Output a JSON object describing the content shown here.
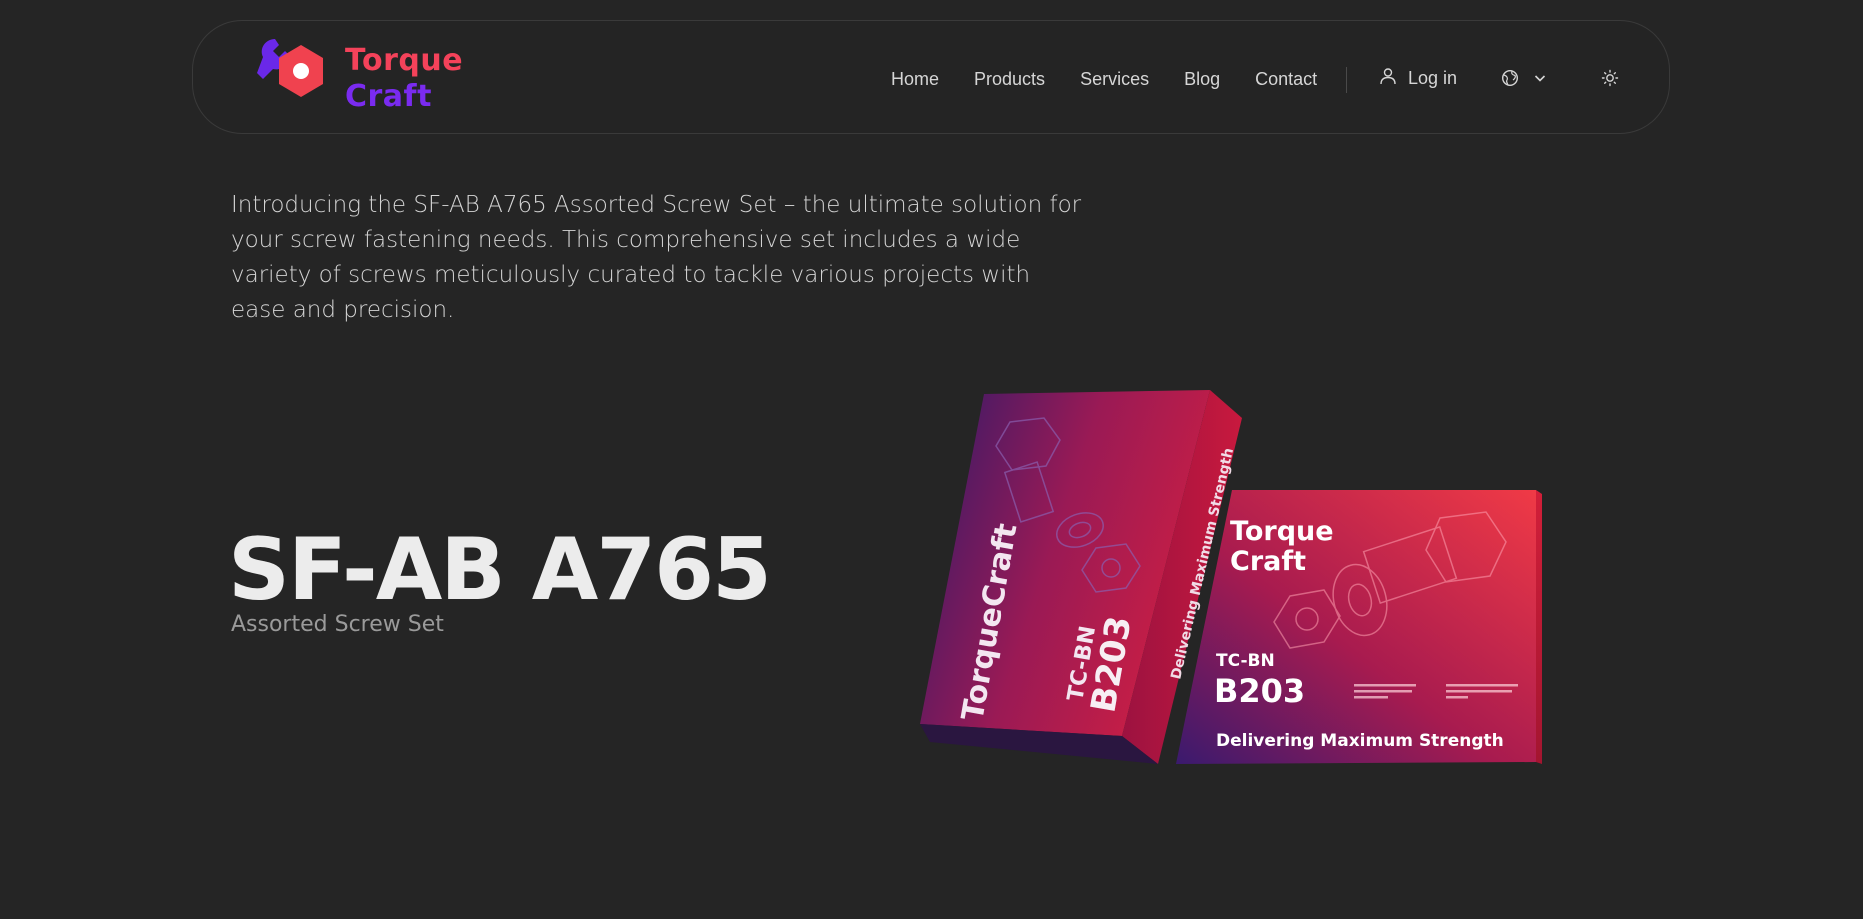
{
  "brand": {
    "line1": "Torque",
    "line2": "Craft",
    "colors": {
      "primary": "#f4425a",
      "secondary": "#7a2bf0"
    }
  },
  "nav": {
    "links": [
      "Home",
      "Products",
      "Services",
      "Blog",
      "Contact"
    ],
    "login_label": "Log in",
    "language_icon": "globe-icon",
    "theme_icon": "sun-icon"
  },
  "intro": {
    "text": "Introducing the SF-AB A765 Assorted Screw Set – the ultimate solution for your screw fastening needs. This comprehensive set includes a wide variety of screws meticulously curated to tackle various projects with ease and precision."
  },
  "hero": {
    "title": "SF-AB A765",
    "subtitle": "Assorted Screw Set"
  },
  "product_image": {
    "brand_vertical": "TorqueCraft",
    "brand_front_line1": "Torque",
    "brand_front_line2": "Craft",
    "model_prefix": "TC-BN",
    "model_code": "B203",
    "tagline": "Delivering Maximum Strength",
    "colors": {
      "box_start": "#3a1a6e",
      "box_mid": "#9d1a52",
      "box_end": "#ef3346"
    }
  }
}
